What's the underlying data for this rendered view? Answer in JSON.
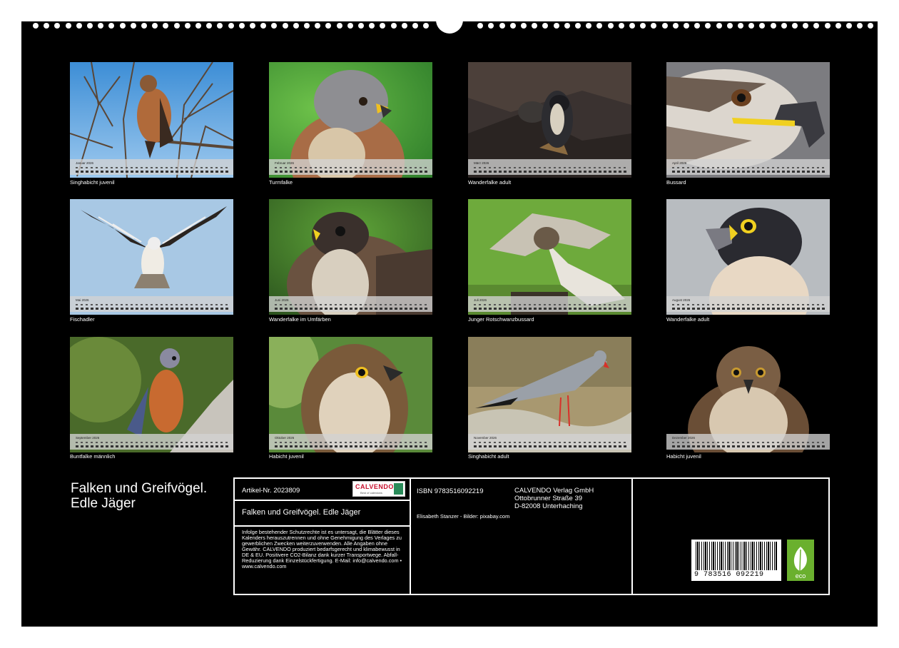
{
  "calendar_title": "Falken und Greifvögel. Edle Jäger",
  "months": [
    {
      "label": "Januar 2026",
      "caption": "Singhabicht juvenil"
    },
    {
      "label": "Februar 2026",
      "caption": "Turmfalke"
    },
    {
      "label": "März 2026",
      "caption": "Wanderfalke adult"
    },
    {
      "label": "April 2026",
      "caption": "Bussard"
    },
    {
      "label": "Mai 2026",
      "caption": "Fischadler"
    },
    {
      "label": "Juni 2026",
      "caption": "Wanderfalke im Umfärben"
    },
    {
      "label": "Juli 2026",
      "caption": "Junger Rotschwanzbussard"
    },
    {
      "label": "August 2026",
      "caption": "Wanderfalke adult"
    },
    {
      "label": "September 2026",
      "caption": "Buntfalke männlich"
    },
    {
      "label": "Oktober 2026",
      "caption": "Habicht juvenil"
    },
    {
      "label": "November 2026",
      "caption": "Singhabicht adult"
    },
    {
      "label": "Dezember 2026",
      "caption": "Habicht juvenil"
    }
  ],
  "info": {
    "article": "Artikel-Nr. 2023809",
    "logo_text": "CALVENDO",
    "logo_sub": "Best of calendars",
    "product_title": "Falken und Greifvögel. Edle Jäger",
    "legal": "Infolge bestehender Schutzrechte ist es untersagt, die Blätter dieses Kalenders herauszutrennen und ohne Genehmigung des Verlages zu gewerblichen Zwecken weiterzuverwenden. Alle Angaben ohne Gewähr. CALVENDO produziert bedarfsgerecht und klimabewusst in DE & EU. Positivere CO2-Bilanz dank kurzer Transportwege. Abfall-Reduzierung dank Einzelstückfertigung. E-Mail: info@calvendo.com • www.calvendo.com",
    "isbn": "ISBN 9783516092219",
    "publisher_name": "CALVENDO Verlag GmbH",
    "publisher_street": "Ottobrunner Straße 39",
    "publisher_city": "D-82008 Unterhaching",
    "credits": "Elisabeth Stanzer - Bilder: pixabay.com",
    "barcode_number": "9 783516 092219",
    "eco_label": "eco"
  }
}
